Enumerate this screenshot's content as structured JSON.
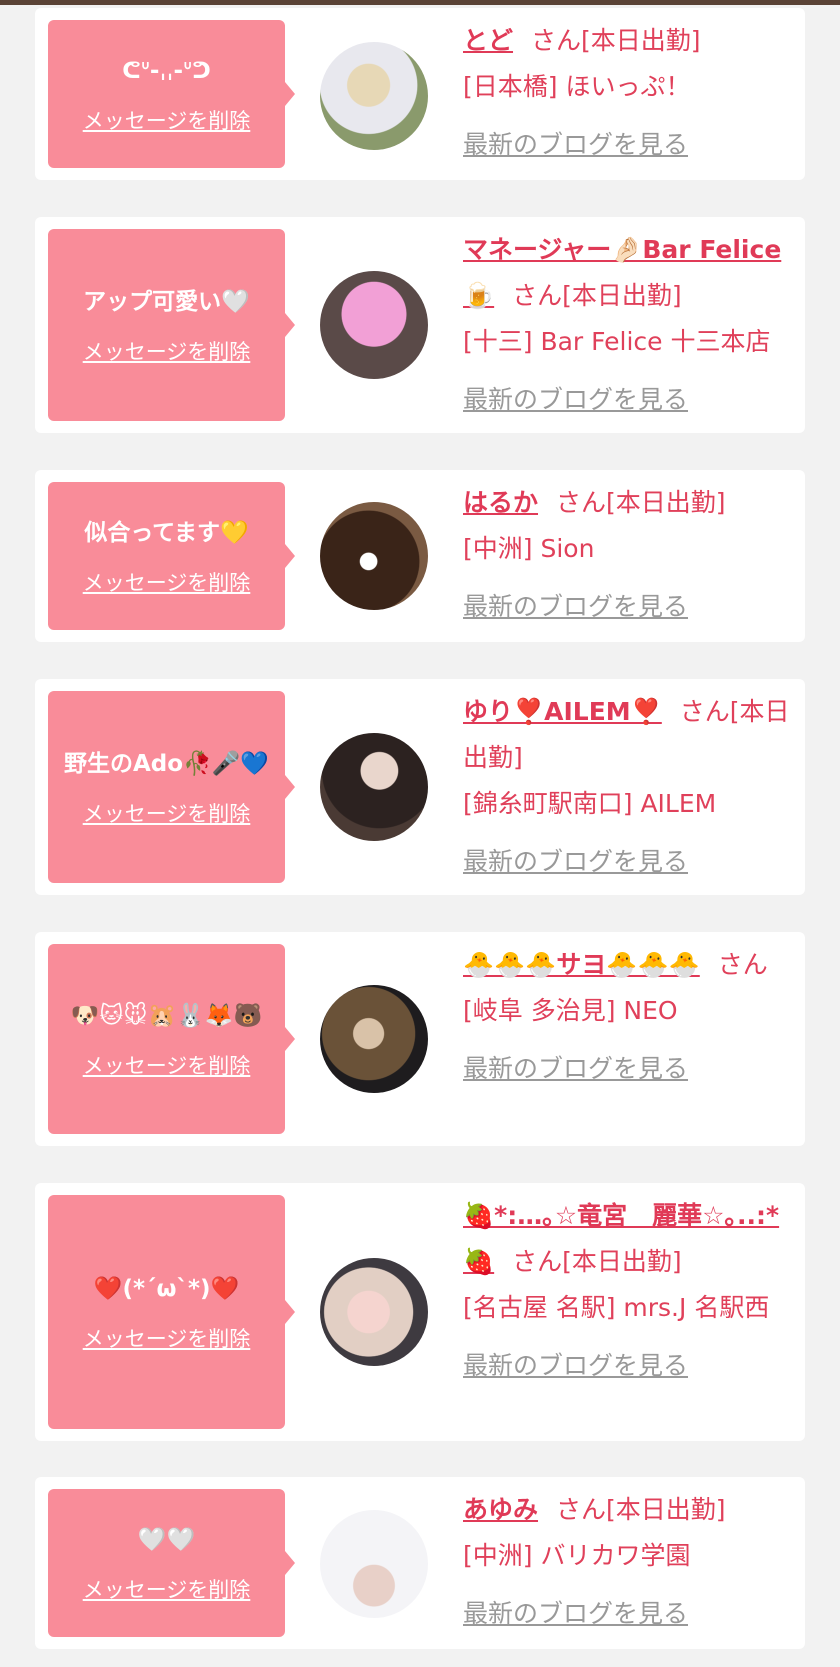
{
  "colors": {
    "bubble": "#f98c99",
    "accent": "#e0405a",
    "muted": "#999999",
    "card": "#ffffff",
    "bg": "#f2f2f2"
  },
  "delete_label": "メッセージを削除",
  "blog_label": "最新のブログを見る",
  "entries": [
    {
      "message": "ᕦᐡ-ˌˌ-ᐡᕤ",
      "name": "とど",
      "suffix": "さん[本日出勤]",
      "shop": "[日本橋] ほいっぷ！",
      "avatar_icon": "photo-avatar"
    },
    {
      "message": "アップ可愛い🤍",
      "name": "マネージャー🤌🏻Bar Felice🍺",
      "suffix": "さん[本日出勤]",
      "shop": "[十三] Bar Felice 十三本店",
      "avatar_icon": "heart-cover-avatar"
    },
    {
      "message": "似合ってます💛",
      "name": "はるか",
      "suffix": "さん[本日出勤]",
      "shop": "[中洲] Sion",
      "avatar_icon": "photo-avatar"
    },
    {
      "message": "野生のAdo🥀🎤💙",
      "name": "ゆり❣️AILEM❣️",
      "suffix": "さん[本日出勤]",
      "shop": "[錦糸町駅南口] AILEM",
      "avatar_icon": "photo-avatar"
    },
    {
      "message": "🐶🐱🐭🐹🐰🦊🐻",
      "name": "🐣🐣🐣サヨ🐣🐣🐣",
      "suffix": "さん",
      "shop": "[岐阜 多治見] NEO",
      "avatar_icon": "photo-avatar"
    },
    {
      "message": "❤️(*´ω`*)❤️",
      "name": "🍓*:…｡☆竜宮　麗華☆｡..:*🍓",
      "suffix": "さん[本日出勤]",
      "shop": "[名古屋 名駅] mrs.J 名駅西",
      "avatar_icon": "photo-avatar"
    },
    {
      "message": "🤍🤍",
      "name": "あゆみ",
      "suffix": "さん[本日出勤]",
      "shop": "[中洲] バリカワ学園",
      "avatar_icon": "photo-avatar"
    }
  ]
}
